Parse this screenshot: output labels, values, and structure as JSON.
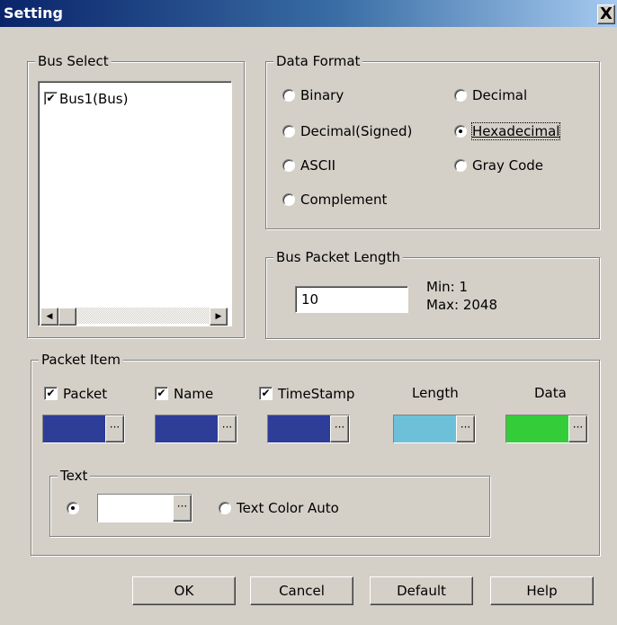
{
  "window": {
    "title": "Setting",
    "close_glyph": "X"
  },
  "bus_select": {
    "legend": "Bus Select",
    "items": [
      {
        "label": "Bus1(Bus)",
        "checked": true
      }
    ]
  },
  "data_format": {
    "legend": "Data Format",
    "options": [
      {
        "label": "Binary",
        "selected": false
      },
      {
        "label": "Decimal",
        "selected": false
      },
      {
        "label": "Decimal(Signed)",
        "selected": false
      },
      {
        "label": "Hexadecimal",
        "selected": true
      },
      {
        "label": "ASCII",
        "selected": false
      },
      {
        "label": "Gray Code",
        "selected": false
      },
      {
        "label": "Complement",
        "selected": false
      }
    ]
  },
  "bus_packet_length": {
    "legend": "Bus Packet Length",
    "value": "10",
    "min_label": "Min: 1",
    "max_label": "Max: 2048"
  },
  "packet_item": {
    "legend": "Packet Item",
    "items": [
      {
        "label": "Packet",
        "checked": true,
        "color": "#2e3d98"
      },
      {
        "label": "Name",
        "checked": true,
        "color": "#2e3d98"
      },
      {
        "label": "TimeStamp",
        "checked": true,
        "color": "#2e3d98"
      },
      {
        "label": "Length",
        "checked": null,
        "color": "#6ec0d8"
      },
      {
        "label": "Data",
        "checked": null,
        "color": "#35cc3a"
      }
    ],
    "ellipsis": "···",
    "text_group": {
      "legend": "Text",
      "color": "#ffffff",
      "custom_selected": true,
      "auto_label": "Text Color Auto"
    }
  },
  "buttons": {
    "ok": "OK",
    "cancel": "Cancel",
    "default": "Default",
    "help": "Help"
  },
  "icons": {
    "scroll_left": "scroll-left-arrow-icon",
    "scroll_right": "scroll-right-arrow-icon"
  }
}
